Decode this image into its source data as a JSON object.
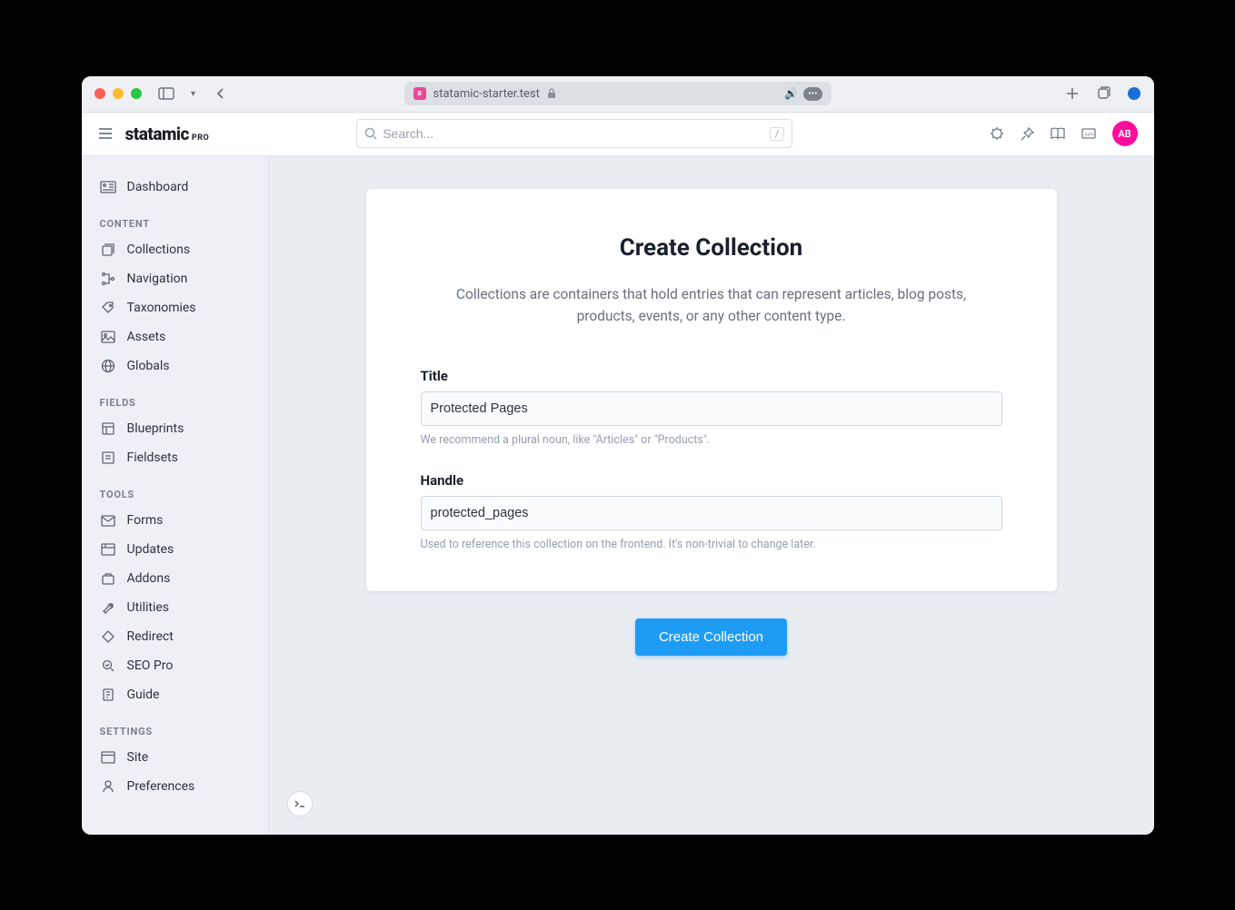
{
  "browser": {
    "url": "statamic-starter.test",
    "favicon_letter": "s"
  },
  "brand": {
    "name": "statamic",
    "tier": "PRO"
  },
  "search": {
    "placeholder": "Search...",
    "shortcut": "/"
  },
  "avatar": "AB",
  "sidebar": {
    "dashboard": "Dashboard",
    "groups": [
      {
        "heading": "CONTENT",
        "items": [
          {
            "label": "Collections",
            "icon": "collections"
          },
          {
            "label": "Navigation",
            "icon": "navigation"
          },
          {
            "label": "Taxonomies",
            "icon": "tag"
          },
          {
            "label": "Assets",
            "icon": "image"
          },
          {
            "label": "Globals",
            "icon": "globe"
          }
        ]
      },
      {
        "heading": "FIELDS",
        "items": [
          {
            "label": "Blueprints",
            "icon": "blueprint"
          },
          {
            "label": "Fieldsets",
            "icon": "fieldset"
          }
        ]
      },
      {
        "heading": "TOOLS",
        "items": [
          {
            "label": "Forms",
            "icon": "forms"
          },
          {
            "label": "Updates",
            "icon": "updates"
          },
          {
            "label": "Addons",
            "icon": "addons"
          },
          {
            "label": "Utilities",
            "icon": "utilities"
          },
          {
            "label": "Redirect",
            "icon": "redirect"
          },
          {
            "label": "SEO Pro",
            "icon": "seo"
          },
          {
            "label": "Guide",
            "icon": "guide"
          }
        ]
      },
      {
        "heading": "SETTINGS",
        "items": [
          {
            "label": "Site",
            "icon": "site"
          },
          {
            "label": "Preferences",
            "icon": "preferences"
          }
        ]
      }
    ]
  },
  "page": {
    "title": "Create Collection",
    "description": "Collections are containers that hold entries that can represent articles, blog posts, products, events, or any other content type.",
    "fields": {
      "title": {
        "label": "Title",
        "value": "Protected Pages",
        "help": "We recommend a plural noun, like \"Articles\" or \"Products\"."
      },
      "handle": {
        "label": "Handle",
        "value": "protected_pages",
        "help": "Used to reference this collection on the frontend. It's non-trivial to change later."
      }
    },
    "submit": "Create Collection"
  }
}
